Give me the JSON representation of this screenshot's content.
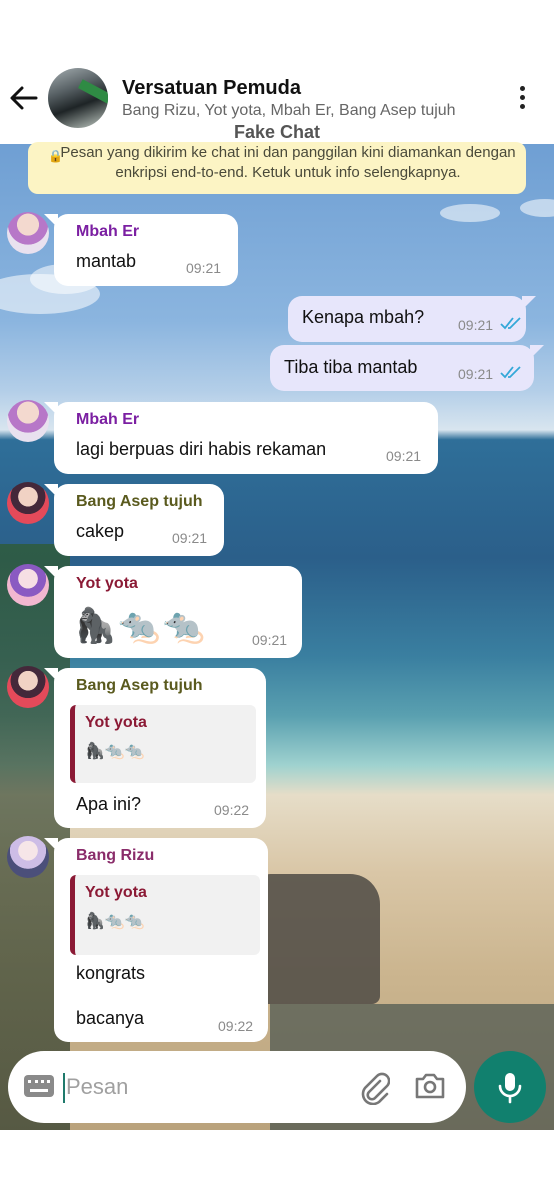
{
  "header": {
    "title": "Versatuan Pemuda",
    "subtitle": "Bang Rizu, Yot yota, Mbah Er, Bang Asep tujuh",
    "label": "Fake Chat"
  },
  "notice": {
    "text": "Pesan yang dikirim ke chat ini dan panggilan kini diamankan dengan enkripsi end-to-end. Ketuk untuk info selengkapnya."
  },
  "messages": [
    {
      "sender": "Mbah Er",
      "text": "mantab",
      "time": "09:21"
    },
    {
      "text": "Kenapa mbah?",
      "time": "09:21"
    },
    {
      "text": "Tiba tiba mantab",
      "time": "09:21"
    },
    {
      "sender": "Mbah Er",
      "text": "lagi berpuas diri habis rekaman",
      "time": "09:21"
    },
    {
      "sender": "Bang Asep tujuh",
      "text": "cakep",
      "time": "09:21"
    },
    {
      "sender": "Yot yota",
      "text": "🦍🐀🐀",
      "time": "09:21"
    },
    {
      "sender": "Bang Asep tujuh",
      "quote_sender": "Yot yota",
      "quote_text": "🦍🐀🐀",
      "text": "Apa ini?",
      "time": "09:22"
    },
    {
      "sender": "Bang Rizu",
      "quote_sender": "Yot yota",
      "quote_text": "🦍🐀🐀",
      "text": "kongrats",
      "text2": "bacanya",
      "time": "09:22"
    }
  ],
  "colors": {
    "mbah_er": "#7b1fa2",
    "bang_asep": "#5a5a1e",
    "yot_yota": "#8b1a35",
    "bang_rizu": "#8a2c6a",
    "tick": "#34a8d8",
    "accent": "#11806e"
  },
  "input": {
    "placeholder": "Pesan"
  },
  "icons": {
    "back": "arrow-left-icon",
    "menu": "more-vert-icon",
    "lock": "lock-icon",
    "keyboard": "keyboard-icon",
    "attach": "paperclip-icon",
    "camera": "camera-icon",
    "mic": "mic-icon"
  }
}
